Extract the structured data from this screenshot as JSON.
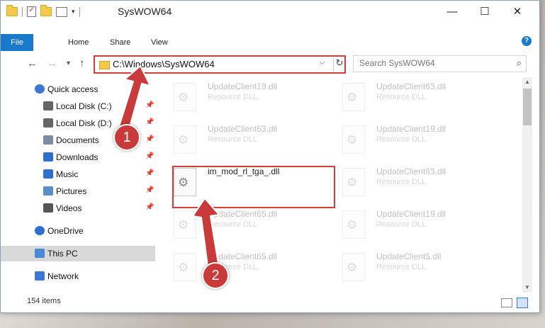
{
  "window": {
    "title": "SysWOW64",
    "minimize_glyph": "—",
    "maximize_glyph": "☐",
    "close_glyph": "✕"
  },
  "quick_access_toolbar": {
    "dropdown_glyph": "▾"
  },
  "ribbon": {
    "tabs": [
      "File",
      "Home",
      "Share",
      "View"
    ],
    "help_glyph": "?"
  },
  "navigation": {
    "back_glyph": "←",
    "forward_glyph": "→",
    "recent_glyph": "▾",
    "up_glyph": "↑"
  },
  "address_bar": {
    "path": "C:\\Windows\\SysWOW64",
    "dropdown_glyph": "⌵",
    "refresh_glyph": "↻"
  },
  "search": {
    "placeholder": "Search SysWOW64",
    "icon_glyph": "⌕"
  },
  "sidebar": {
    "items": [
      {
        "label": "Quick access",
        "icon": "star-icon",
        "color": "#3a78d4",
        "pinned": false
      },
      {
        "label": "Local Disk (C:)",
        "icon": "drive-icon",
        "color": "#666666",
        "pinned": true
      },
      {
        "label": "Local Disk (D:)",
        "icon": "drive-icon",
        "color": "#666666",
        "pinned": true
      },
      {
        "label": "Documents",
        "icon": "documents-icon",
        "color": "#7d8ca3",
        "pinned": true
      },
      {
        "label": "Downloads",
        "icon": "download-icon",
        "color": "#2f6fd0",
        "pinned": true
      },
      {
        "label": "Music",
        "icon": "music-icon",
        "color": "#2f6fd0",
        "pinned": true
      },
      {
        "label": "Pictures",
        "icon": "pictures-icon",
        "color": "#5a8fc9",
        "pinned": true
      },
      {
        "label": "Videos",
        "icon": "videos-icon",
        "color": "#555555",
        "pinned": true
      },
      {
        "label": "OneDrive",
        "icon": "cloud-icon",
        "color": "#2f6fd0",
        "pinned": false
      },
      {
        "label": "This PC",
        "icon": "computer-icon",
        "color": "#4a8ad8",
        "pinned": false,
        "selected": true
      },
      {
        "label": "Network",
        "icon": "network-icon",
        "color": "#3a78d4",
        "pinned": false
      }
    ],
    "pin_glyph": "📌"
  },
  "files": [
    {
      "name": "UpdateClient19.dll",
      "type": "Resource DLL",
      "faded": true
    },
    {
      "name": "UpdateClient63.dll",
      "type": "Resource DLL",
      "faded": true
    },
    {
      "name": "UpdateClient63.dll",
      "type": "Resource DLL",
      "faded": true
    },
    {
      "name": "UpdateClient19.dll",
      "type": "Resource DLL",
      "faded": true
    },
    {
      "name": "im_mod_rl_tga_.dll",
      "type": "",
      "faded": false
    },
    {
      "name": "UpdateClient63.dll",
      "type": "Resource DLL",
      "faded": true
    },
    {
      "name": "UpdateClient65.dll",
      "type": "Resource DLL",
      "faded": true
    },
    {
      "name": "UpdateClient19.dll",
      "type": "Resource DLL",
      "faded": true
    },
    {
      "name": "UpdateClient65.dll",
      "type": "Resource DLL",
      "faded": true
    },
    {
      "name": "UpdateClient5.dll",
      "type": "Resource DLL",
      "faded": true
    }
  ],
  "status_bar": {
    "item_count": "154 items"
  },
  "scrollbar": {
    "up_glyph": "▲",
    "down_glyph": "▼"
  },
  "annotations": {
    "step1": "1",
    "step2": "2",
    "highlight_color": "#d33c3c"
  }
}
